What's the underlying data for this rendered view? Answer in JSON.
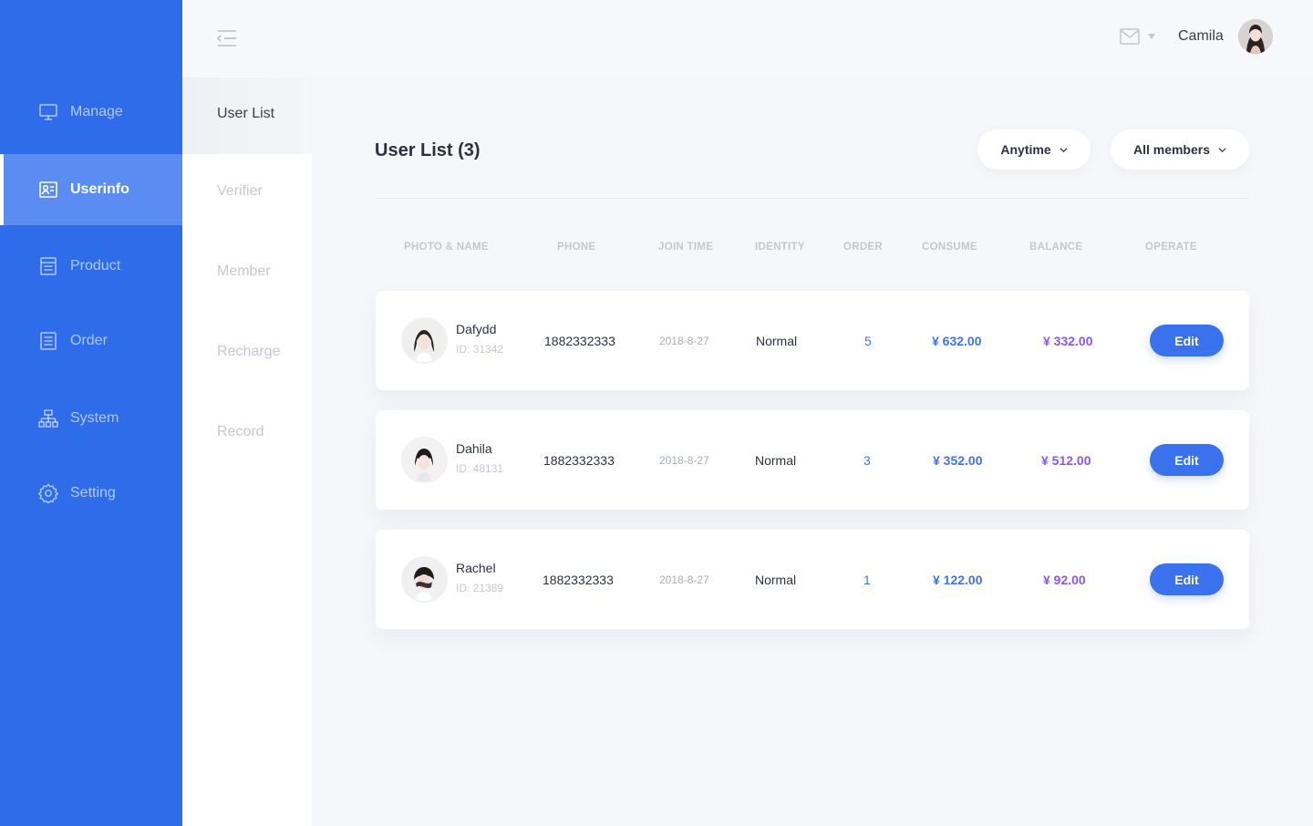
{
  "header": {
    "username": "Camila"
  },
  "sidebar": {
    "items": [
      {
        "label": "Manage",
        "icon": "monitor-icon"
      },
      {
        "label": "Userinfo",
        "icon": "id-card-icon"
      },
      {
        "label": "Product",
        "icon": "document-icon"
      },
      {
        "label": "Order",
        "icon": "list-icon"
      },
      {
        "label": "System",
        "icon": "hierarchy-icon"
      },
      {
        "label": "Setting",
        "icon": "gear-icon"
      }
    ],
    "active": "Userinfo"
  },
  "submenu": {
    "items": [
      "User List",
      "Verifier",
      "Member",
      "Recharge",
      "Record"
    ],
    "active": "User List"
  },
  "main": {
    "title": "User List (3)",
    "filters": {
      "time": "Anytime",
      "members": "All members"
    },
    "columns": [
      "PHOTO & NAME",
      "PHONE",
      "JOIN TIME",
      "IDENTITY",
      "ORDER",
      "CONSUME",
      "BALANCE",
      "OPERATE"
    ],
    "rows": [
      {
        "name": "Dafydd",
        "id": "ID: 31342",
        "phone": "1882332333",
        "join_time": "2018-8-27",
        "identity": "Normal",
        "order": "5",
        "consume": "¥ 632.00",
        "balance": "¥ 332.00",
        "action": "Edit"
      },
      {
        "name": "Dahila",
        "id": "ID: 48131",
        "phone": "1882332333",
        "join_time": "2018-8-27",
        "identity": "Normal",
        "order": "3",
        "consume": "¥ 352.00",
        "balance": "¥ 512.00",
        "action": "Edit"
      },
      {
        "name": "Rachel",
        "id": "ID: 21389",
        "phone": "1882332333",
        "join_time": "2018-8-27",
        "identity": "Normal",
        "order": "1",
        "consume": "¥ 122.00",
        "balance": "¥ 92.00",
        "action": "Edit"
      }
    ]
  },
  "colors": {
    "sidebar": "#2e6ce9",
    "sidebar_active": "#5a8cf2",
    "accent_blue": "#3f73e6",
    "accent_purple": "#8d57e2",
    "button": "#3a72ee"
  }
}
